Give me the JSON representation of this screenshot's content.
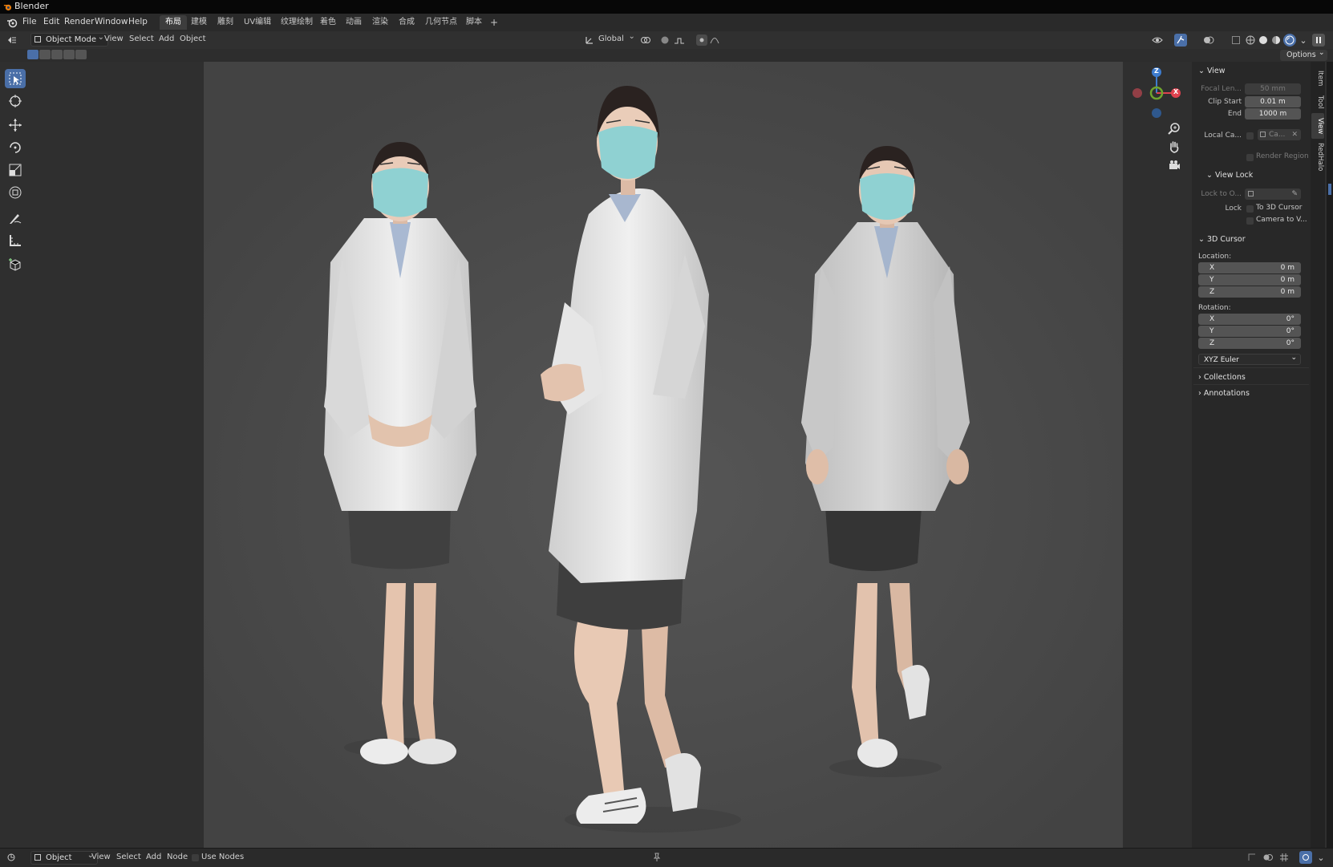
{
  "app": {
    "title": "Blender"
  },
  "menus": [
    "File",
    "Edit",
    "Render",
    "Window",
    "Help"
  ],
  "workspaces": [
    "布局",
    "建模",
    "雕刻",
    "UV编辑",
    "纹理绘制",
    "着色",
    "动画",
    "渲染",
    "合成",
    "几何节点",
    "脚本"
  ],
  "workspace_add": "+",
  "header": {
    "mode": "Object Mode",
    "items": [
      "View",
      "Select",
      "Add",
      "Object"
    ],
    "orientation": "Global",
    "options_label": "Options"
  },
  "npanel": {
    "view": {
      "title": "View",
      "focal_label": "Focal Len...",
      "focal_value": "50 mm",
      "clip_start_label": "Clip Start",
      "clip_start_value": "0.01 m",
      "end_label": "End",
      "end_value": "1000 m",
      "local_camera_label": "Local Ca...",
      "local_camera_value": "Ca...",
      "render_region_label": "Render Region"
    },
    "view_lock": {
      "title": "View Lock",
      "lock_to_label": "Lock to O...",
      "lock_label": "Lock",
      "to_cursor_label": "To 3D Cursor",
      "camera_to_view_label": "Camera to V..."
    },
    "cursor": {
      "title": "3D Cursor",
      "location_label": "Location:",
      "loc_x_label": "X",
      "loc_x": "0 m",
      "loc_y_label": "Y",
      "loc_y": "0 m",
      "loc_z_label": "Z",
      "loc_z": "0 m",
      "rotation_label": "Rotation:",
      "rot_x_label": "X",
      "rot_x": "0°",
      "rot_y_label": "Y",
      "rot_y": "0°",
      "rot_z_label": "Z",
      "rot_z": "0°",
      "rotation_mode": "XYZ Euler"
    },
    "collections_title": "Collections",
    "annotations_title": "Annotations"
  },
  "side_tabs": [
    "Item",
    "Tool",
    "View",
    "RedHalo"
  ],
  "gizmo": {
    "z": "Z",
    "x": "X"
  },
  "footer": {
    "editor": "Object",
    "items": [
      "View",
      "Select",
      "Add",
      "Node"
    ],
    "use_nodes_label": "Use Nodes"
  },
  "colors": {
    "accent": "#4a6fa8",
    "axis_x": "#e0424f",
    "axis_y": "#6fa52e",
    "axis_z": "#3e7ccf",
    "coat": "#e6e6e6",
    "mask": "#8fd1d2",
    "skirt": "#3f3f3f",
    "skin": "#e7c8b3"
  }
}
